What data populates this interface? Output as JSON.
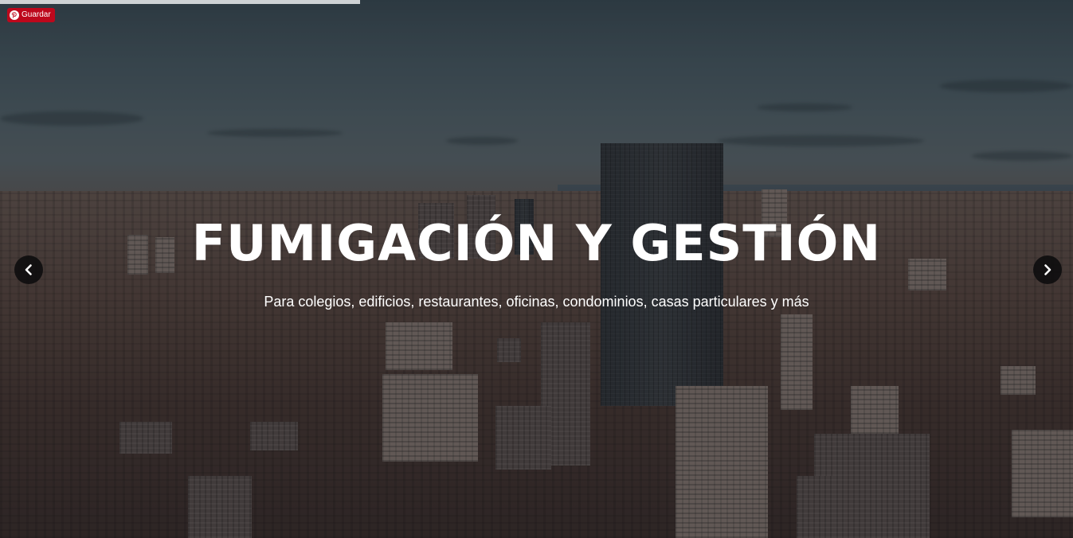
{
  "pinterest": {
    "save_label": "Guardar",
    "brand_color": "#bd081c",
    "icon": "pinterest-icon"
  },
  "slider": {
    "title": "FUMIGACIÓN Y GESTIÓN",
    "subtitle": "Para colegios, edificios, restaurantes, oficinas, condominios, casas particulares y más",
    "prev_icon": "chevron-left-icon",
    "next_icon": "chevron-right-icon"
  }
}
